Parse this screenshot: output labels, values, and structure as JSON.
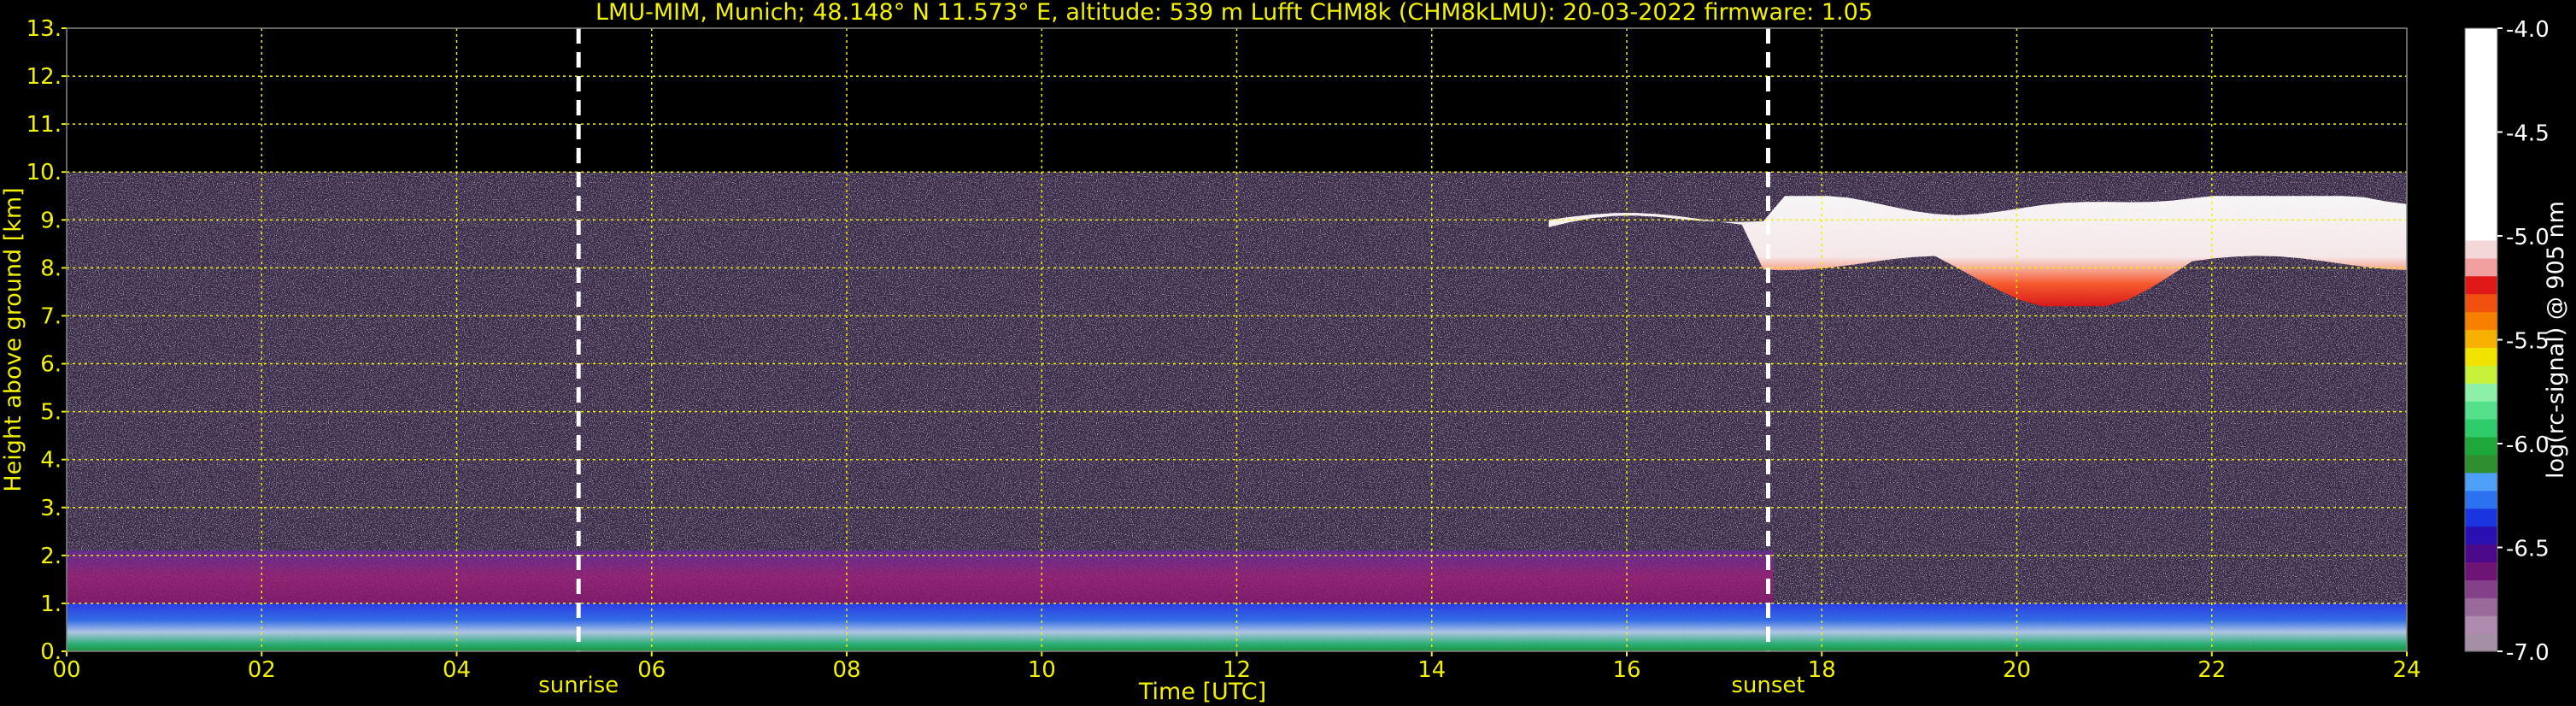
{
  "chart_data": {
    "type": "heatmap",
    "title": "LMU-MIM, Munich; 48.148° N 11.573° E, altitude: 539 m    Lufft CHM8k (CHM8kLMU): 20-03-2022    firmware: 1.05",
    "xlabel": "Time [UTC]",
    "ylabel": "Height above ground [km]",
    "xlim": [
      0,
      24
    ],
    "ylim": [
      0,
      13
    ],
    "x_ticks": [
      "00",
      "02",
      "04",
      "06",
      "08",
      "10",
      "12",
      "14",
      "16",
      "18",
      "20",
      "22",
      "24"
    ],
    "y_ticks": [
      "0.",
      "1.",
      "2.",
      "3.",
      "4.",
      "5.",
      "6.",
      "7.",
      "8.",
      "9.",
      "10.",
      "11.",
      "12.",
      "13."
    ],
    "grid": true,
    "grid_color": "#f2f200",
    "data_top_km": 10,
    "markers": [
      {
        "label": "sunrise",
        "time_h": 5.25
      },
      {
        "label": "sunset",
        "time_h": 17.45
      }
    ],
    "colorbar": {
      "label": "log(rc-signal) @ 905 nm",
      "range": [
        -7.0,
        -4.0
      ],
      "ticks": [
        "-4.0",
        "-4.5",
        "-5.0",
        "-5.5",
        "-6.0",
        "-6.5",
        "-7.0"
      ],
      "colors": [
        "#a58fa5",
        "#b08bb0",
        "#9a6a9a",
        "#85408a",
        "#6e1475",
        "#4a0a8a",
        "#2a10b0",
        "#1a34e0",
        "#2c72f0",
        "#4ea0f8",
        "#2f8f2f",
        "#1fa83a",
        "#2ecc6a",
        "#55e08a",
        "#8cf0a8",
        "#c8f23a",
        "#f2e200",
        "#f8b000",
        "#f88000",
        "#f05010",
        "#e01818",
        "#f0a0a0",
        "#f2d8d8",
        "#ffffff"
      ]
    },
    "layers": [
      {
        "name": "cloud layer",
        "from_h": 15.2,
        "to_h": 24.0,
        "base_km": 7.2,
        "top_km": 9.5,
        "value": -4.2
      },
      {
        "name": "residual layer",
        "from_h": 0.0,
        "to_h": 17.5,
        "base_km": 1.0,
        "top_km": 2.1,
        "value": -6.4
      },
      {
        "name": "boundary layer",
        "from_h": 0.0,
        "to_h": 24.0,
        "base_km": 0.0,
        "top_km": 1.0,
        "value": -6.2
      }
    ]
  }
}
